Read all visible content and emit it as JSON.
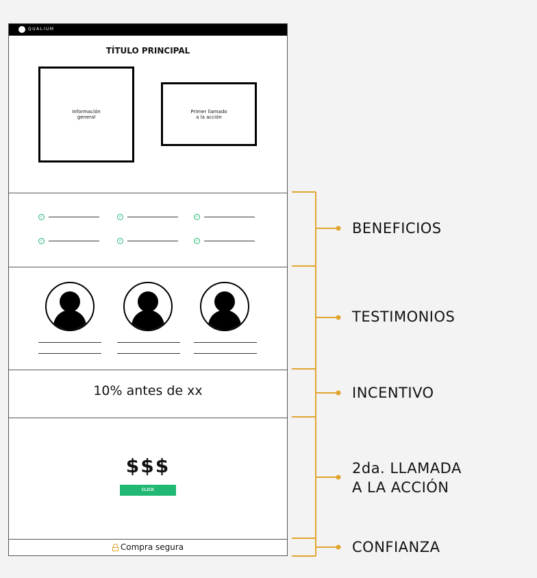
{
  "brand": {
    "logo_text": "QUALIUM"
  },
  "hero": {
    "title": "TÍTULO PRINCIPAL",
    "info_box": "Información\ngeneral",
    "cta_box": "Primer llamado\na la acción"
  },
  "benefits_count": 6,
  "testimonials_count": 3,
  "incentive": {
    "text": "10% antes de xx"
  },
  "second_cta": {
    "price": "$$$",
    "button_label": "CLICK"
  },
  "trust": {
    "text": "Compra segura"
  },
  "annotations": [
    {
      "id": "beneficios",
      "label": "BENEFICIOS"
    },
    {
      "id": "testimonios",
      "label": "TESTIMONIOS"
    },
    {
      "id": "incentivo",
      "label": "INCENTIVO"
    },
    {
      "id": "llamada",
      "label": "2da. LLAMADA\nA LA ACCIÓN"
    },
    {
      "id": "confianza",
      "label": "CONFIANZA"
    }
  ],
  "colors": {
    "accent": "#21b873",
    "bracket": "#e0a52e",
    "background": "#f3f3f3"
  }
}
